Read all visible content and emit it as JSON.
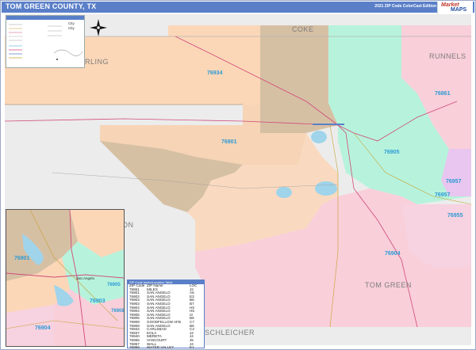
{
  "title": "TOM GREEN COUNTY, TX",
  "edition": "2021 ZIP Code ColorCast Edition",
  "logo": {
    "line1": "Market",
    "line2": "MAPS"
  },
  "colors": {
    "title_bar": "#5a7fc8",
    "peach": "#fbd7b8",
    "tan": "#d6c0a4",
    "mint": "#b7f3dc",
    "pink": "#f9cfd9",
    "purple": "#e9c6ef",
    "green": "#c9efc9",
    "gray": "#ececec",
    "zip_label": "#2c9ad6",
    "water": "#9fd4ea"
  },
  "legend": {
    "items": [
      "City",
      "City"
    ]
  },
  "counties": [
    {
      "name": "COKE"
    },
    {
      "name": "STERLING"
    },
    {
      "name": "RUNNELS"
    },
    {
      "name": "TOM GREEN"
    },
    {
      "name": "SCHLEICHER"
    },
    {
      "name": "ON"
    }
  ],
  "zips_main": [
    {
      "code": "76934"
    },
    {
      "code": "76901"
    },
    {
      "code": "76905"
    },
    {
      "code": "76861"
    },
    {
      "code": "76957"
    },
    {
      "code": "76957"
    },
    {
      "code": "76955"
    },
    {
      "code": "76904"
    }
  ],
  "zips_inset": [
    {
      "code": "76901"
    },
    {
      "code": "76903"
    },
    {
      "code": "76904"
    },
    {
      "code": "76905"
    },
    {
      "code": "76908"
    }
  ],
  "inset_city": "San Angelo",
  "zip_table": {
    "title": "ZIP Code Index/Location Table",
    "headers": [
      "ZIP Code",
      "ZIP Name",
      "LOC"
    ],
    "rows": [
      [
        "76861",
        "MILES",
        "J2"
      ],
      [
        "76901",
        "SAN ANGELO",
        "A6"
      ],
      [
        "76902",
        "SAN ANGELO",
        "E3"
      ],
      [
        "76903",
        "SAN ANGELO",
        "B6"
      ],
      [
        "76903",
        "SAN ANGELO",
        "B7"
      ],
      [
        "76904",
        "SAN ANGELO",
        "H5"
      ],
      [
        "76904",
        "SAN ANGELO",
        "H5"
      ],
      [
        "76905",
        "SAN ANGELO",
        "I3"
      ],
      [
        "76905",
        "SAN ANGELO",
        "B6"
      ],
      [
        "76908",
        "GOODFELLOW AFB",
        "C7"
      ],
      [
        "76909",
        "SAN ANGELO",
        "B6"
      ],
      [
        "76934",
        "CARLSBAD",
        "C2"
      ],
      [
        "76937",
        "EOLA",
        "J4"
      ],
      [
        "76940",
        "MERETA",
        "J4"
      ],
      [
        "76955",
        "VANCOURT",
        "J5"
      ],
      [
        "76957",
        "WALL",
        "J4"
      ],
      [
        "76958",
        "WATER VALLEY",
        "E1"
      ]
    ]
  }
}
